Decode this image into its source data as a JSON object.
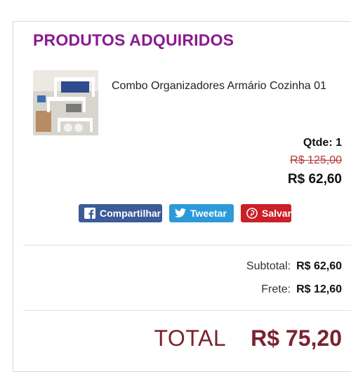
{
  "section": {
    "title": "PRODUTOS ADQUIRIDOS"
  },
  "product": {
    "image_alt": "shelf organizer photo",
    "name": "Combo Organizadores Armário Cozinha 01",
    "quantity_label": "Qtde: 1",
    "old_price": "R$ 125,00",
    "price": "R$ 62,60"
  },
  "share": {
    "facebook_label": "Compartilhar",
    "twitter_label": "Tweetar",
    "pinterest_label": "Salvar",
    "colors": {
      "facebook": "#3b5b99",
      "twitter": "#2c9ad9",
      "pinterest": "#cb2027"
    }
  },
  "summary": {
    "subtotal_label": "Subtotal:",
    "subtotal_value": "R$ 62,60",
    "shipping_label": "Frete:",
    "shipping_value": "R$ 12,60",
    "total_label": "TOTAL",
    "total_value": "R$ 75,20"
  },
  "colors": {
    "title": "#8a1a8f",
    "total": "#7a2330",
    "old_price": "#b23a3a"
  }
}
